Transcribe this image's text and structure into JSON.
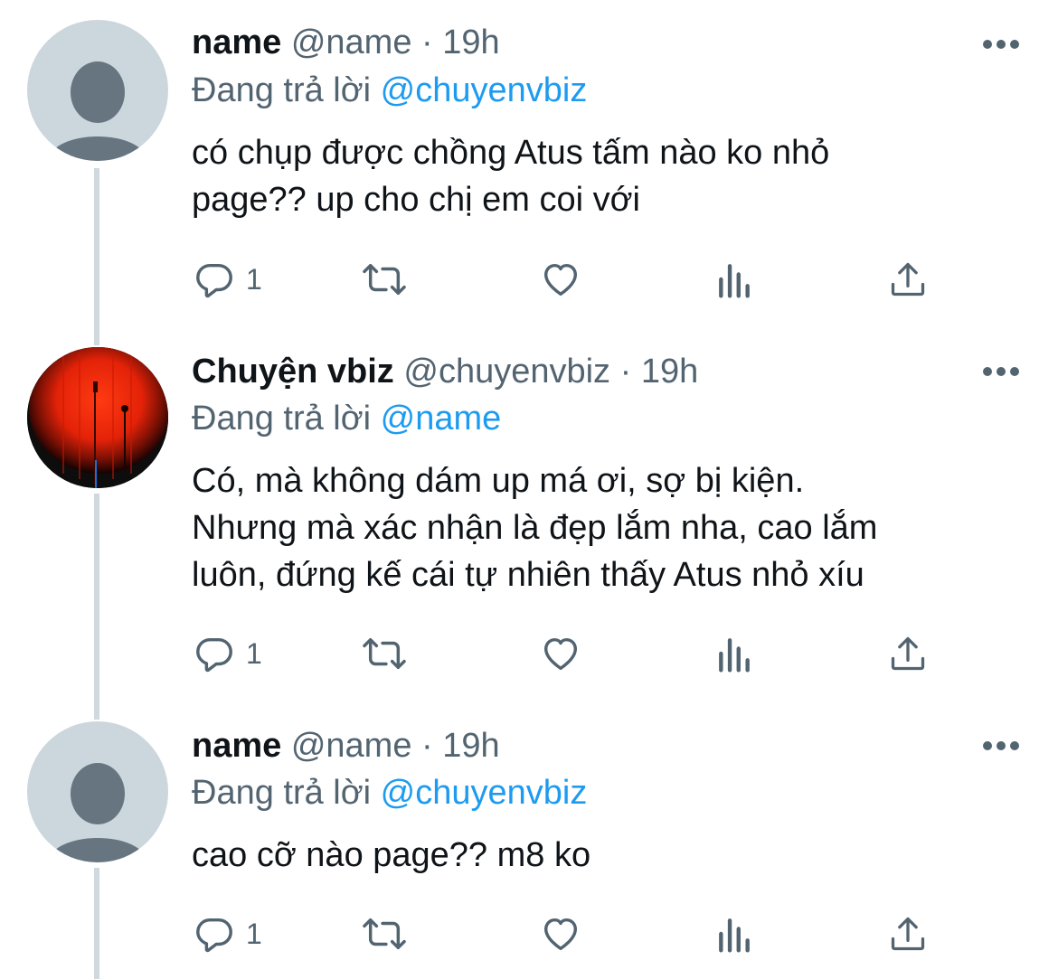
{
  "tweets": [
    {
      "name": "name",
      "handle": "@name",
      "dot": "·",
      "time": "19h",
      "reply_prefix": "Đang trả lời",
      "reply_to": "@chuyenvbiz",
      "text_lines": [
        "có chụp được chồng Atus tấm nào ko nhỏ",
        "page?? up cho chị em coi với"
      ],
      "avatar": "default-avatar",
      "reply_count": "1"
    },
    {
      "name": "Chuyện vbiz",
      "handle": "@chuyenvbiz",
      "dot": "·",
      "time": "19h",
      "reply_prefix": "Đang trả lời",
      "reply_to": "@name",
      "text_lines": [
        "Có, mà không dám up má ơi, sợ bị kiện.",
        "Nhưng mà xác nhận là đẹp lắm nha, cao lắm",
        "luôn, đứng kế cái tự nhiên thấy Atus nhỏ xíu"
      ],
      "avatar": "stage-photo-avatar",
      "reply_count": "1"
    },
    {
      "name": "name",
      "handle": "@name",
      "dot": "·",
      "time": "19h",
      "reply_prefix": "Đang trả lời",
      "reply_to": "@chuyenvbiz",
      "text_lines": [
        "cao cỡ nào page?? m8 ko"
      ],
      "avatar": "default-avatar",
      "reply_count": "1"
    }
  ],
  "colors": {
    "text": "#0f1419",
    "secondary": "#536471",
    "link": "#1d9bf0",
    "thread_line": "#cfd9de",
    "default_avatar_bg": "#ccd6dd",
    "default_avatar_fg": "#66757f"
  },
  "icons": [
    "reply-icon",
    "retweet-icon",
    "like-icon",
    "analytics-icon",
    "share-icon",
    "more-icon"
  ]
}
